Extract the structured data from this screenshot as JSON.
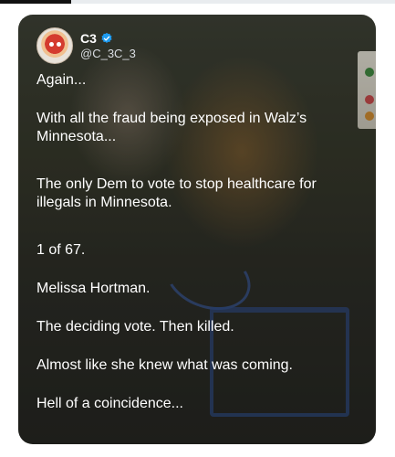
{
  "post": {
    "author": {
      "display_name": "C3",
      "handle": "@C_3C_3",
      "verified": true,
      "avatar_icon": "avatar-icon"
    },
    "paragraphs": [
      "Again...",
      "With all the fraud being exposed in Walz’s Minnesota...",
      "The only Dem to vote to stop healthcare for illegals in Minnesota.",
      "1 of 67.",
      "Melissa Hortman.",
      "The deciding vote. Then killed.",
      "Almost like she knew what was coming.",
      "Hell of a coincidence..."
    ]
  },
  "colors": {
    "text": "#ffffff",
    "verified_badge": "#1d9bf0",
    "card_background": "#2f3229"
  }
}
